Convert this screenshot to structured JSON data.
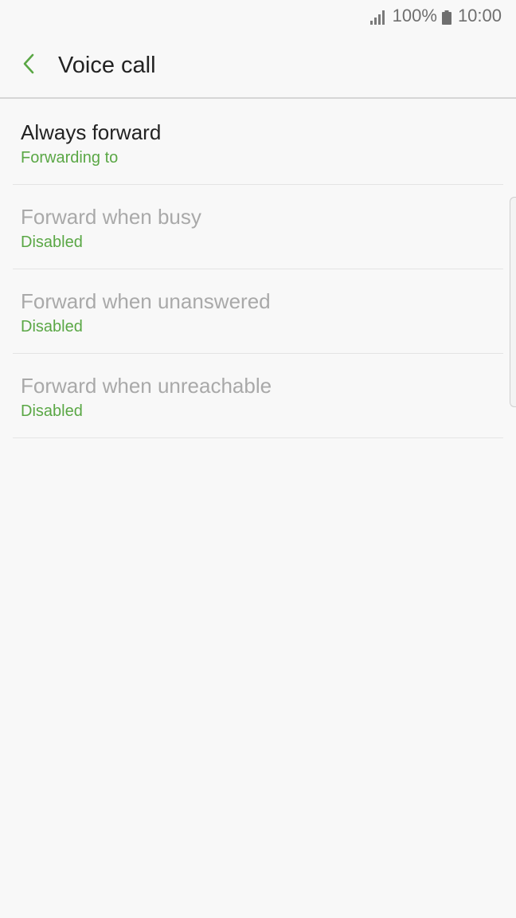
{
  "status_bar": {
    "signal_icon": "signal-icon",
    "battery_percent": "100%",
    "battery_icon": "battery-icon",
    "time": "10:00"
  },
  "app_bar": {
    "back_icon": "back-arrow-icon",
    "title": "Voice call"
  },
  "colors": {
    "accent": "#5aa745",
    "title_enabled": "#222222",
    "title_disabled": "#a9a9a9",
    "background": "#f8f8f8"
  },
  "list": {
    "items": [
      {
        "title": "Always forward",
        "subtitle": "Forwarding to",
        "state": "enabled"
      },
      {
        "title": "Forward when busy",
        "subtitle": "Disabled",
        "state": "disabled"
      },
      {
        "title": "Forward when unanswered",
        "subtitle": "Disabled",
        "state": "disabled"
      },
      {
        "title": "Forward when unreachable",
        "subtitle": "Disabled",
        "state": "disabled"
      }
    ]
  }
}
